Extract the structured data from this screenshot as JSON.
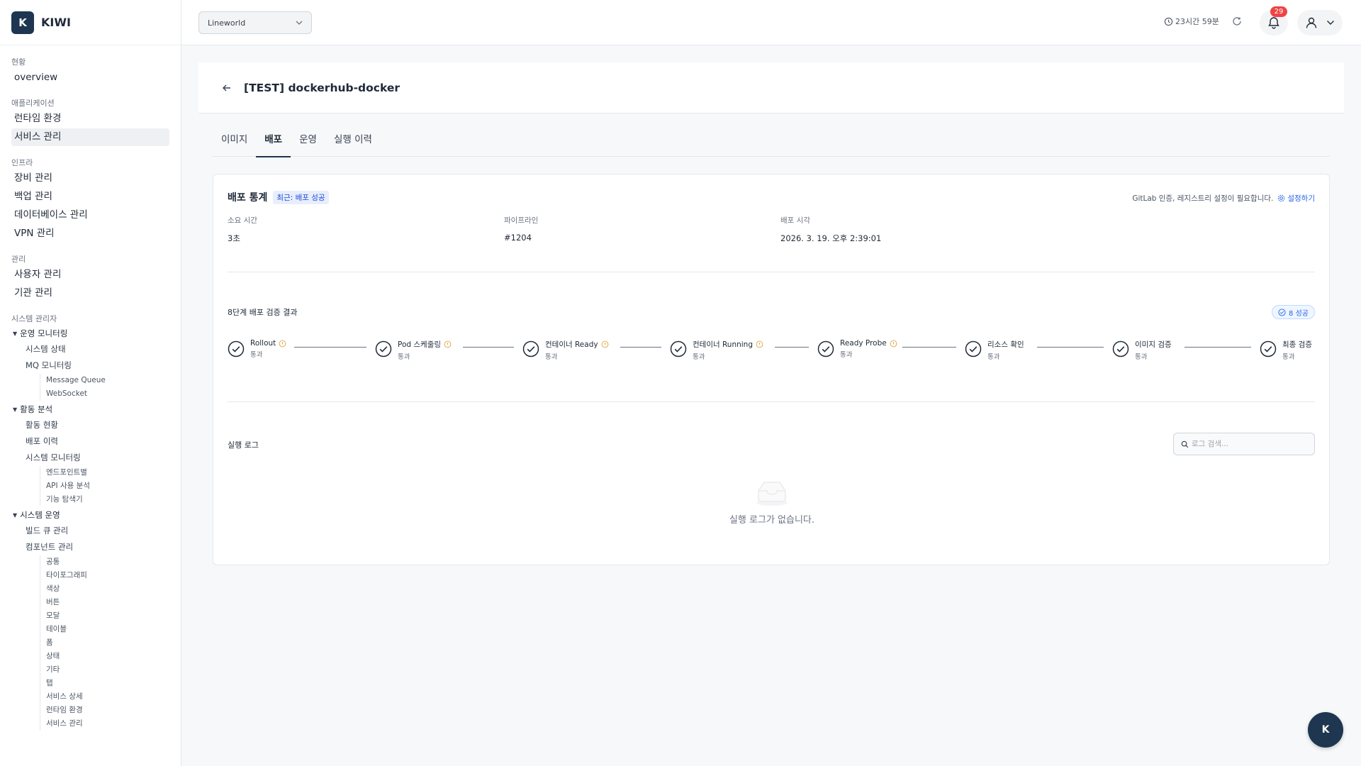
{
  "brand": {
    "logo_letter": "K",
    "name": "KIWI"
  },
  "sidebar": {
    "status_title": "현황",
    "overview": "overview",
    "app_title": "애플리케이션",
    "runtime": "런타임 환경",
    "service": "서비스 관리",
    "infra_title": "인프라",
    "equipment": "장비 관리",
    "backup": "백업 관리",
    "database": "데이터베이스 관리",
    "vpn": "VPN 관리",
    "admin_title": "관리",
    "users": "사용자 관리",
    "orgs": "기관 관리",
    "sysadmin_title": "시스템 관리자",
    "ops_monitoring": "운영 모니터링",
    "system_status": "시스템 상태",
    "mq_monitoring": "MQ 모니터링",
    "message_queue": "Message Queue",
    "websocket": "WebSocket",
    "activity": "활동 분석",
    "activity_status": "활동 현황",
    "deploy_history": "배포 이력",
    "system_monitoring": "시스템 모니터링",
    "endpoint": "엔드포인트별",
    "api_usage": "API 사용 분석",
    "feature_explorer": "기능 탐색기",
    "system_ops": "시스템 운영",
    "build_queue": "빌드 큐 관리",
    "component": "컴포넌트 관리",
    "leaves": [
      "공통",
      "타이포그래피",
      "색상",
      "버튼",
      "모달",
      "테이블",
      "폼",
      "상태",
      "기타",
      "탭",
      "서비스 상세",
      "런타임 환경",
      "서비스 관리"
    ]
  },
  "topbar": {
    "project": "Lineworld",
    "session_time": "23시간 59분",
    "notification_count": "29"
  },
  "page": {
    "title": "[TEST] dockerhub-docker",
    "tabs": [
      "이미지",
      "배포",
      "운영",
      "실행 이력"
    ]
  },
  "deploy_stats": {
    "title": "배포 통계",
    "status_chip": "최근: 배포 성공",
    "gitlab_note": "GitLab 인증, 레지스트리 설정이 필요합니다.",
    "setup_link": "설정하기",
    "duration_label": "소요 시간",
    "duration_value": "3초",
    "pipeline_label": "파이프라인",
    "pipeline_value": "#1204",
    "time_label": "배포 시각",
    "time_value": "2026. 3. 19. 오후 2:39:01"
  },
  "verification": {
    "title": "8단계 배포 검증 결과",
    "success_pill": "8 성공",
    "steps": [
      {
        "name": "Rollout",
        "status": "통과"
      },
      {
        "name": "Pod 스케줄링",
        "status": "통과"
      },
      {
        "name": "컨테이너 Ready",
        "status": "통과"
      },
      {
        "name": "컨테이너 Running",
        "status": "통과"
      },
      {
        "name": "Ready Probe",
        "status": "통과"
      },
      {
        "name": "리소스 확인",
        "status": "통과"
      },
      {
        "name": "이미지 검증",
        "status": "통과"
      },
      {
        "name": "최종 검증",
        "status": "통과"
      }
    ]
  },
  "logs": {
    "title": "실행 로그",
    "search_placeholder": "로그 검색...",
    "empty": "실행 로그가 없습니다."
  },
  "fab": {
    "label": "K"
  },
  "colors": {
    "brand": "#1e3650",
    "accent": "#2563eb",
    "badge": "#ef4444",
    "warn": "#e0a43c"
  }
}
